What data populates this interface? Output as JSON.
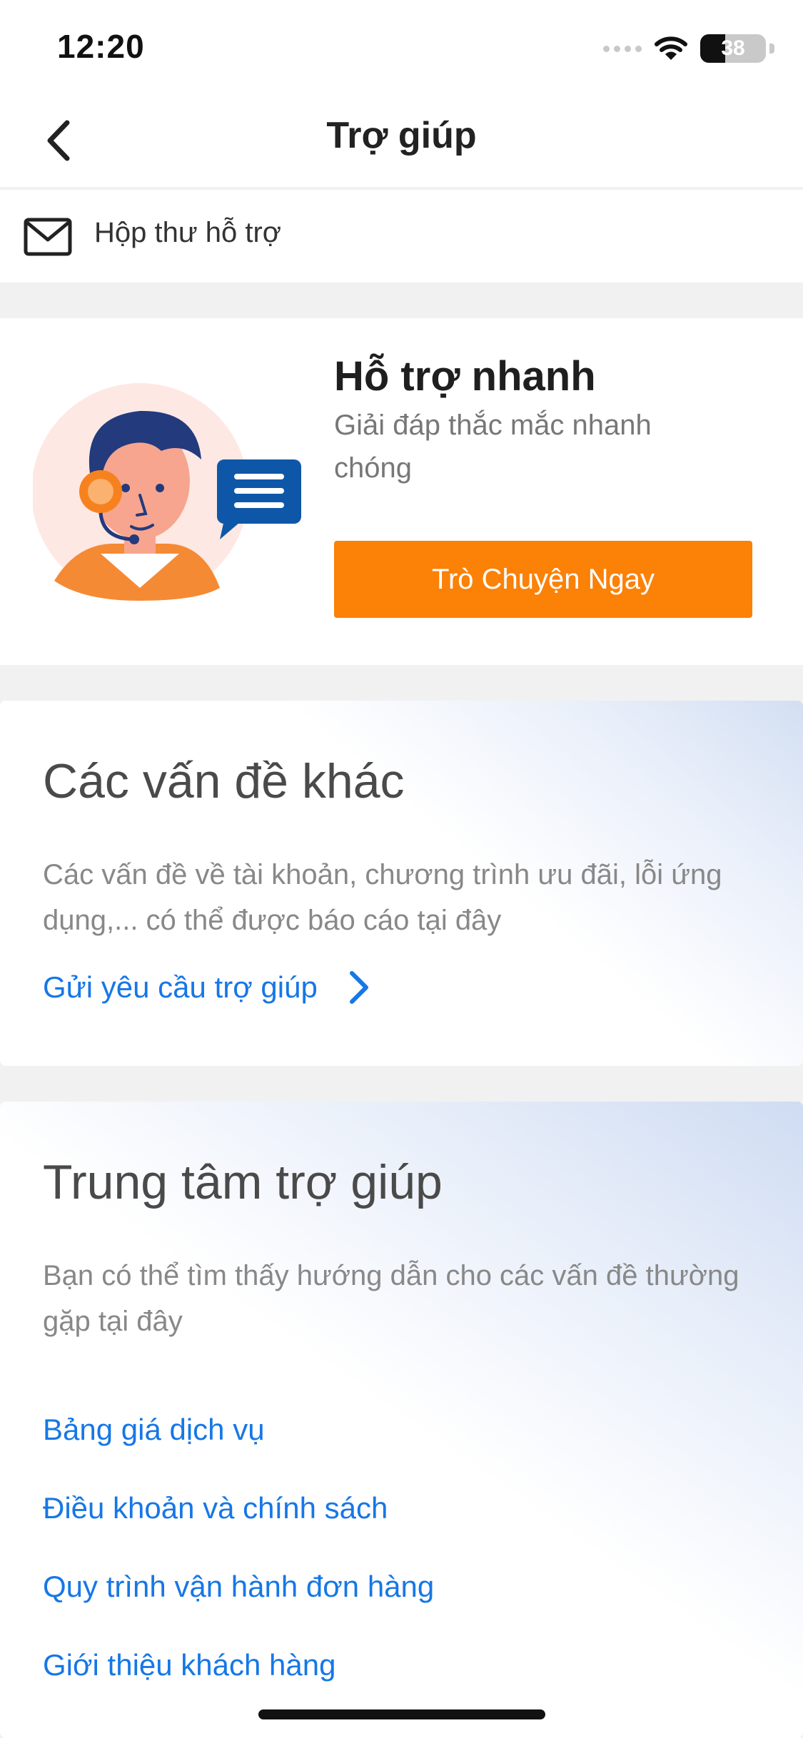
{
  "status_bar": {
    "time": "12:20",
    "battery": "38",
    "battery_level": 0.38
  },
  "nav": {
    "title": "Trợ giúp",
    "back_icon": "chevron-left-icon"
  },
  "inbox": {
    "label": "Hộp thư hỗ trợ",
    "icon": "mail-icon"
  },
  "quick_support": {
    "title": "Hỗ trợ nhanh",
    "subtitle": "Giải đáp thắc mắc nhanh chóng",
    "button_label": "Trò Chuyện Ngay",
    "accent": "#fb8107"
  },
  "other_issues": {
    "title": "Các vấn đề khác",
    "description": "Các vấn đề về tài khoản, chương trình ưu đãi, lỗi ứng dụng,... có thể được báo cáo tại đây",
    "link_label": "Gửi yêu cầu trợ giúp",
    "link_color": "#1677e6"
  },
  "help_center": {
    "title": "Trung tâm trợ giúp",
    "description": "Bạn có thể tìm thấy hướng dẫn cho các vấn đề thường gặp tại đây",
    "links": [
      "Bảng giá dịch vụ",
      "Điều khoản và chính sách",
      "Quy trình vận hành đơn hàng",
      "Giới thiệu khách hàng"
    ]
  }
}
